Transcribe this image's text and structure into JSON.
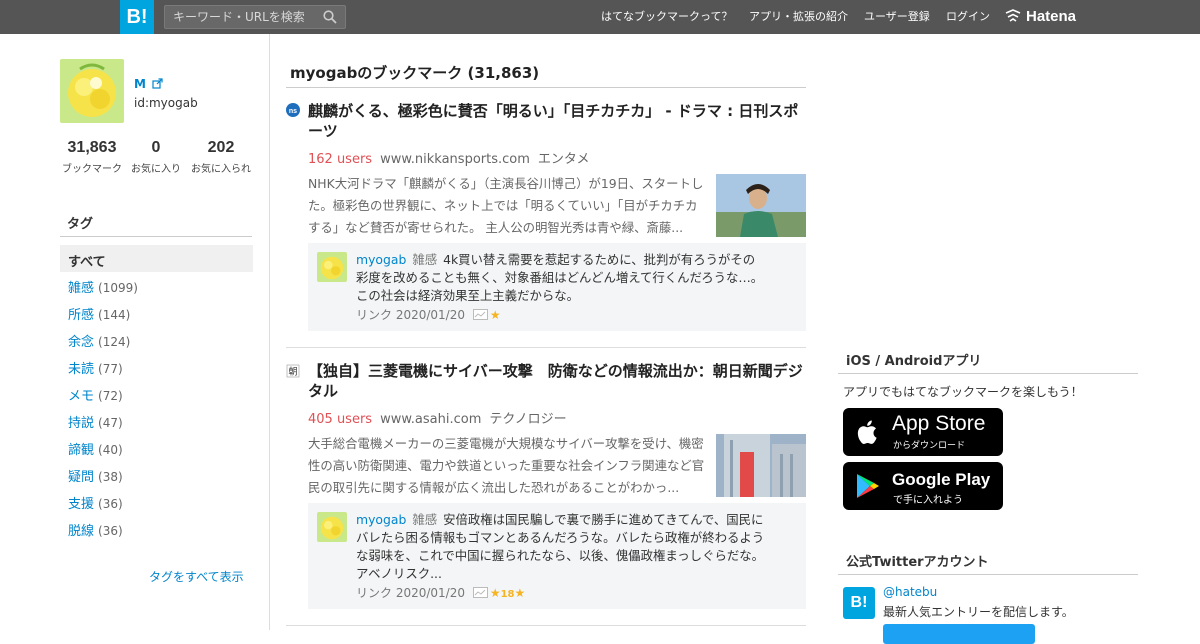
{
  "topbar": {
    "logo": "B!",
    "search_placeholder": "キーワード・URLを検索",
    "nav": [
      "はてなブックマークって？",
      "アプリ・拡張の紹介",
      "ユーザー登録",
      "ログイン"
    ],
    "hatena": "Hatena"
  },
  "profile": {
    "name": "M",
    "id": "id:myogab",
    "stats": [
      {
        "num": "31,863",
        "label": "ブックマーク"
      },
      {
        "num": "0",
        "label": "お気に入り"
      },
      {
        "num": "202",
        "label": "お気に入られ"
      }
    ]
  },
  "tags": {
    "heading": "タグ",
    "all": "すべて",
    "items": [
      {
        "name": "雑感",
        "count": "(1099)"
      },
      {
        "name": "所感",
        "count": "(144)"
      },
      {
        "name": "余念",
        "count": "(124)"
      },
      {
        "name": "未読",
        "count": "(77)"
      },
      {
        "name": "メモ",
        "count": "(72)"
      },
      {
        "name": "持説",
        "count": "(47)"
      },
      {
        "name": "諦観",
        "count": "(40)"
      },
      {
        "name": "疑問",
        "count": "(38)"
      },
      {
        "name": "支援",
        "count": "(36)"
      },
      {
        "name": "脱線",
        "count": "(36)"
      }
    ],
    "more": "タグをすべて表示"
  },
  "main": {
    "title": "myogabのブックマーク (31,863)",
    "entries": [
      {
        "title": "麒麟がくる、極彩色に賛否「明るい」「目チカチカ」 - ドラマ : 日刊スポーツ",
        "users": "162 users",
        "site": "www.nikkansports.com",
        "category": "エンタメ",
        "desc": "NHK大河ドラマ「麒麟がくる」（主演長谷川博己）が19日、スタートした。極彩色の世界観に、ネット上では「明るくていい」「目がチカチカする」など賛否が寄せられた。 主人公の明智光秀は青や緑、斎藤...",
        "comment": {
          "user": "myogab",
          "tag": "雑感",
          "text": "4k買い替え需要を惹起するために、批判が有ろうがその彩度を改めることも無く、対象番組はどんどん増えて行くんだろうな…。この社会は経済効果至上主義だからな。",
          "foot": "リンク 2020/01/20",
          "stars": "",
          "star_count": ""
        }
      },
      {
        "title": "【独自】三菱電機にサイバー攻撃　防衛などの情報流出か：朝日新聞デジタル",
        "users": "405 users",
        "site": "www.asahi.com",
        "category": "テクノロジー",
        "desc": "大手総合電機メーカーの三菱電機が大規模なサイバー攻撃を受け、機密性の高い防衛関連、電力や鉄道といった重要な社会インフラ関連など官民の取引先に関する情報が広く流出した恐れがあることがわかっ...",
        "comment": {
          "user": "myogab",
          "tag": "雑感",
          "text": "安倍政権は国民騙しで裏で勝手に進めてきてんで、国民にバレたら困る情報もゴマンとあるんだろうな。バレたら政権が終わるような弱味を、これで中国に握られたなら、以後、傀儡政権まっしぐらだな。アベノリスク...",
          "foot": "リンク 2020/01/20",
          "stars": "",
          "star_count": "18"
        }
      }
    ]
  },
  "sidebar": {
    "apps_heading": "iOS / Androidアプリ",
    "apps_text": "アプリでもはてなブックマークを楽しもう！",
    "appstore_big": "App Store",
    "appstore_small": "からダウンロード",
    "gplay_big": "Google Play",
    "gplay_small": "で手に入れよう",
    "twitter_heading": "公式Twitterアカウント",
    "twitter_logo": "B!",
    "twitter_handle": "@hatebu",
    "twitter_desc": "最新人気エントリーを配信します。"
  },
  "colors": {
    "topbar": "#555555",
    "brand": "#00a4de",
    "link": "#0085cc",
    "users": "#e05155",
    "star": "#f5b423"
  }
}
